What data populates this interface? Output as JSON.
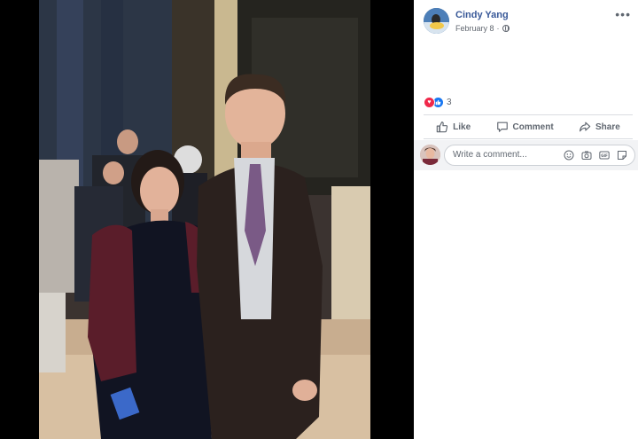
{
  "post": {
    "author": "Cindy Yang",
    "date": "February 8",
    "privacy_icon": "globe-icon",
    "more_label": "•••"
  },
  "reactions": {
    "types": [
      "love",
      "like"
    ],
    "count": "3"
  },
  "actions": {
    "like_label": "Like",
    "comment_label": "Comment",
    "share_label": "Share"
  },
  "composer": {
    "placeholder": "Write a comment...",
    "icons": [
      "emoji-icon",
      "camera-icon",
      "gif-icon",
      "sticker-icon"
    ]
  },
  "colors": {
    "link": "#385898",
    "love": "#f0284a",
    "like": "#1877f2",
    "muted": "#616770"
  }
}
